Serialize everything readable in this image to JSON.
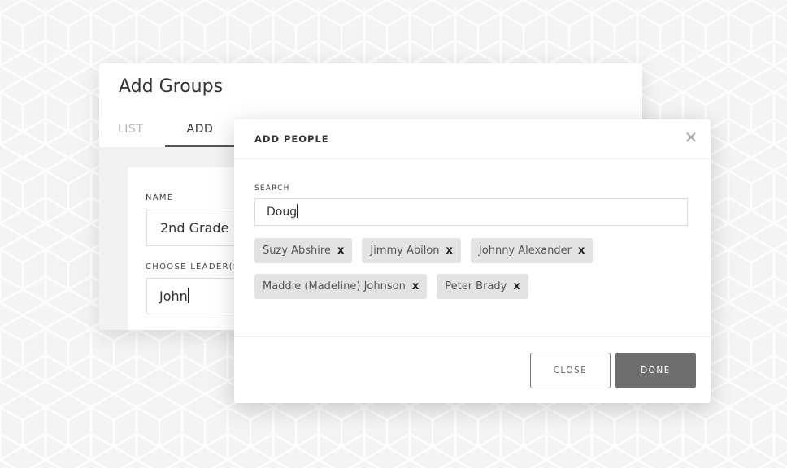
{
  "groups_panel": {
    "title": "Add Groups",
    "tabs": [
      {
        "label": "LIST",
        "active": false
      },
      {
        "label": "ADD",
        "active": true
      }
    ],
    "form": {
      "name_label": "NAME",
      "name_value": "2nd Grade",
      "leader_label": "CHOOSE LEADER(S)",
      "leader_value": "John"
    }
  },
  "modal": {
    "title": "ADD PEOPLE",
    "close_icon": "close-x-icon",
    "search_label": "SEARCH",
    "search_value": "Doug",
    "selected_people": [
      {
        "name": "Suzy Abshire",
        "remove": "x"
      },
      {
        "name": "Jimmy Abilon",
        "remove": "x"
      },
      {
        "name": "Johnny Alexander",
        "remove": "x"
      },
      {
        "name": "Maddie (Madeline) Johnson",
        "remove": "x"
      },
      {
        "name": "Peter Brady",
        "remove": "x"
      }
    ],
    "buttons": {
      "close": "CLOSE",
      "done": "DONE"
    }
  },
  "colors": {
    "done_button": "#6e6e6e",
    "chip_background": "#e3e3e3",
    "page_background": "#f3f3f3"
  }
}
